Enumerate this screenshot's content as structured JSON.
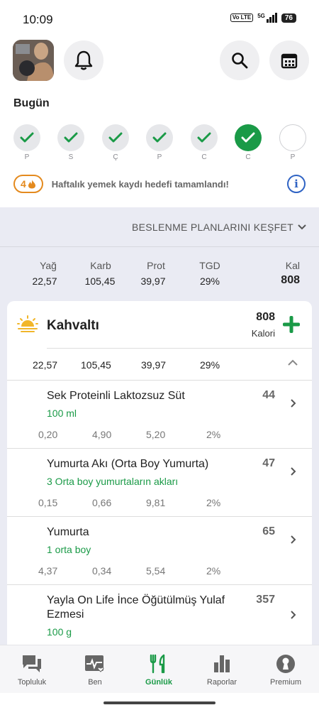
{
  "status": {
    "time": "10:09",
    "network": "5G",
    "volte": "Vo LTE",
    "battery": "76"
  },
  "header": {
    "avatar_icon": "profile-photo",
    "bell_icon": "bell-icon",
    "search_icon": "search-icon",
    "calendar_icon": "calendar-icon"
  },
  "today": {
    "title": "Bugün",
    "days": [
      {
        "label": "P",
        "state": "done"
      },
      {
        "label": "S",
        "state": "done"
      },
      {
        "label": "Ç",
        "state": "done"
      },
      {
        "label": "P",
        "state": "done"
      },
      {
        "label": "C",
        "state": "done"
      },
      {
        "label": "C",
        "state": "active"
      },
      {
        "label": "P",
        "state": "empty"
      }
    ]
  },
  "streak": {
    "count": "4",
    "text": "Haftalık yemek kaydı hedefi tamamlandı!",
    "info_icon": "info-icon"
  },
  "explore": {
    "label": "BESLENME PLANLARINI KEŞFET"
  },
  "summary": {
    "labels": {
      "fat": "Yağ",
      "carb": "Karb",
      "prot": "Prot",
      "tgd": "TGD",
      "kal": "Kal"
    },
    "values": {
      "fat": "22,57",
      "carb": "105,45",
      "prot": "39,97",
      "tgd": "29%",
      "kal": "808"
    }
  },
  "meal": {
    "title": "Kahvaltı",
    "kal": "808",
    "kal_label": "Kalori",
    "macros": {
      "fat": "22,57",
      "carb": "105,45",
      "prot": "39,97",
      "tgd": "29%"
    },
    "foods": [
      {
        "name": "Sek Proteinli Laktozsuz Süt",
        "portion": "100 ml",
        "kal": "44",
        "fat": "0,20",
        "carb": "4,90",
        "prot": "5,20",
        "tgd": "2%"
      },
      {
        "name": "Yumurta Akı (Orta Boy Yumurta)",
        "portion": "3 Orta boy yumurtaların akları",
        "kal": "47",
        "fat": "0,15",
        "carb": "0,66",
        "prot": "9,81",
        "tgd": "2%"
      },
      {
        "name": "Yumurta",
        "portion": "1 orta boy",
        "kal": "65",
        "fat": "4,37",
        "carb": "0,34",
        "prot": "5,54",
        "tgd": "2%"
      },
      {
        "name": "Yayla On Life İnce Öğütülmüş Yulaf Ezmesi",
        "portion": "100 g",
        "kal": "357"
      }
    ]
  },
  "nav": {
    "items": [
      {
        "label": "Topluluk",
        "icon": "chat-icon"
      },
      {
        "label": "Ben",
        "icon": "heart-pulse-icon"
      },
      {
        "label": "Günlük",
        "icon": "fork-knife-icon",
        "active": true
      },
      {
        "label": "Raporlar",
        "icon": "bar-chart-icon"
      },
      {
        "label": "Premium",
        "icon": "premium-icon"
      }
    ]
  },
  "colors": {
    "green": "#1a9a47",
    "orange": "#e48a1e",
    "blue": "#2f63c4",
    "panel": "#eaebf3"
  }
}
